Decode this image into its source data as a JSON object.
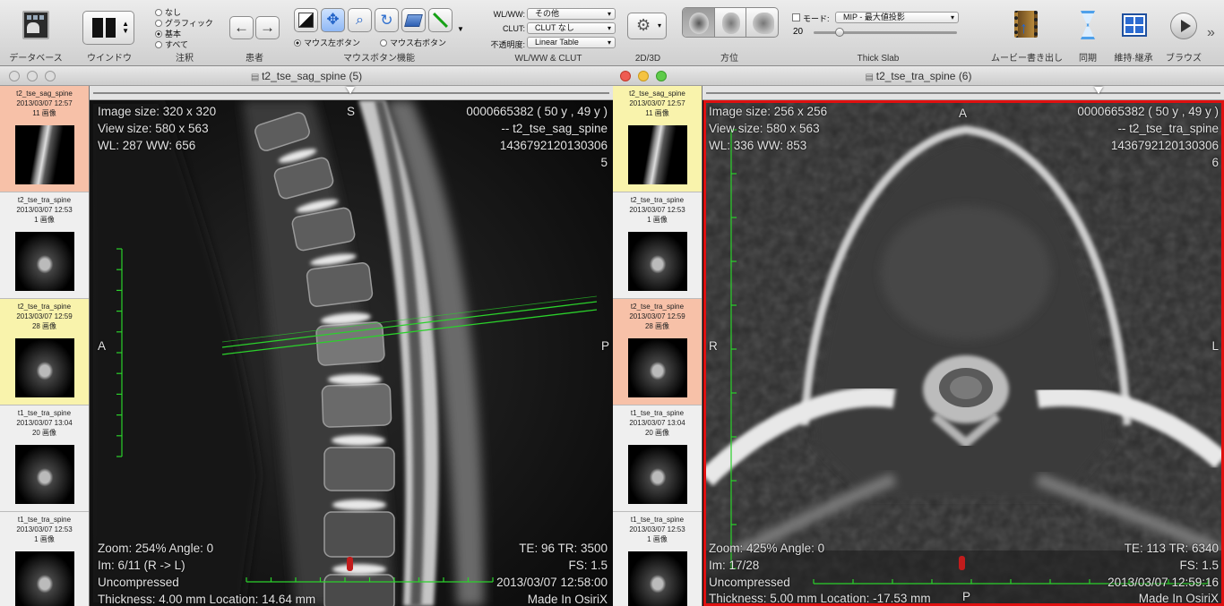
{
  "toolbar": {
    "database": "データベース",
    "window": "ウインドウ",
    "annotation": {
      "label": "注釈",
      "options": [
        "なし",
        "グラフィック",
        "基本",
        "すべて"
      ],
      "selected": "基本"
    },
    "patient": "患者",
    "mouse": {
      "label": "マウスボタン機能",
      "left": "マウス左ボタン",
      "right": "マウス右ボタン"
    },
    "wlww": {
      "label": "WL/WW & CLUT",
      "wl_label": "WL/WW:",
      "wl_value": "その他",
      "clut_label": "CLUT:",
      "clut_value": "CLUT なし",
      "opacity_label": "不透明度:",
      "opacity_value": "Linear Table"
    },
    "twod3d": "2D/3D",
    "orientation": "方位",
    "thickslab": {
      "label": "Thick Slab",
      "mode_label": "モード:",
      "mode_value": "MIP - 最大値投影",
      "value": "20"
    },
    "movie": "ムービー書き出し",
    "sync": "同期",
    "keep": "維持·継承",
    "browse": "ブラウズ"
  },
  "left_window": {
    "title": "t2_tse_sag_spine (5)",
    "thumbnails": [
      {
        "name": "t2_tse_sag_spine",
        "date": "2013/03/07 12:57",
        "count": "11 画像",
        "state": "current"
      },
      {
        "name": "t2_tse_tra_spine",
        "date": "2013/03/07 12:53",
        "count": "1 画像",
        "state": "normal"
      },
      {
        "name": "t2_tse_tra_spine",
        "date": "2013/03/07 12:59",
        "count": "28 画像",
        "state": "linked"
      },
      {
        "name": "t1_tse_tra_spine",
        "date": "2013/03/07 13:04",
        "count": "20 画像",
        "state": "normal"
      },
      {
        "name": "t1_tse_tra_spine",
        "date": "2013/03/07 12:53",
        "count": "1 画像",
        "state": "normal"
      }
    ],
    "overlay": {
      "image_size": "Image size: 320 x 320",
      "view_size": "View size: 580 x 563",
      "wl": "WL: 287 WW: 656",
      "patient_id": "0000665382 (  50 y ,  49 y )",
      "series_name": "-- t2_tse_sag_spine",
      "study_id": "1436792120130306",
      "series_no": "5",
      "zoom": "Zoom: 254%  Angle: 0",
      "im": "Im: 6/11  (R -> L)",
      "compression": "Uncompressed",
      "thickness": "Thickness: 4.00 mm Location: 14.64 mm",
      "te_tr": "TE:  96 TR:  3500",
      "fs": "FS:  1.5",
      "datetime": "2013/03/07 12:58:00",
      "made_in": "Made In OsiriX",
      "orient_top": "S",
      "orient_left": "A",
      "orient_right": "P"
    }
  },
  "right_window": {
    "title": "t2_tse_tra_spine (6)",
    "thumbnails": [
      {
        "name": "t2_tse_sag_spine",
        "date": "2013/03/07 12:57",
        "count": "11 画像",
        "state": "linked"
      },
      {
        "name": "t2_tse_tra_spine",
        "date": "2013/03/07 12:53",
        "count": "1 画像",
        "state": "normal"
      },
      {
        "name": "t2_tse_tra_spine",
        "date": "2013/03/07 12:59",
        "count": "28 画像",
        "state": "current"
      },
      {
        "name": "t1_tse_tra_spine",
        "date": "2013/03/07 13:04",
        "count": "20 画像",
        "state": "normal"
      },
      {
        "name": "t1_tse_tra_spine",
        "date": "2013/03/07 12:53",
        "count": "1 画像",
        "state": "normal"
      }
    ],
    "overlay": {
      "image_size": "Image size: 256 x 256",
      "view_size": "View size: 580 x 563",
      "wl": "WL: 336 WW: 853",
      "patient_id": "0000665382 (  50 y ,  49 y )",
      "series_name": "-- t2_tse_tra_spine",
      "study_id": "1436792120130306",
      "series_no": "6",
      "zoom": "Zoom: 425%  Angle: 0",
      "im": "Im: 17/28",
      "compression": "Uncompressed",
      "thickness": "Thickness: 5.00 mm Location: -17.53 mm",
      "te_tr": "TE:  113 TR:  6340",
      "fs": "FS:  1.5",
      "datetime": "2013/03/07 12:59:16",
      "made_in": "Made In OsiriX",
      "orient_top": "A",
      "orient_left": "R",
      "orient_right": "L",
      "orient_bottom": "P"
    }
  },
  "colors": {
    "active_border": "#e01010",
    "ruler": "#2bd12b",
    "current_thumb": "#f7c1a8",
    "linked_thumb": "#f9f3ac"
  }
}
